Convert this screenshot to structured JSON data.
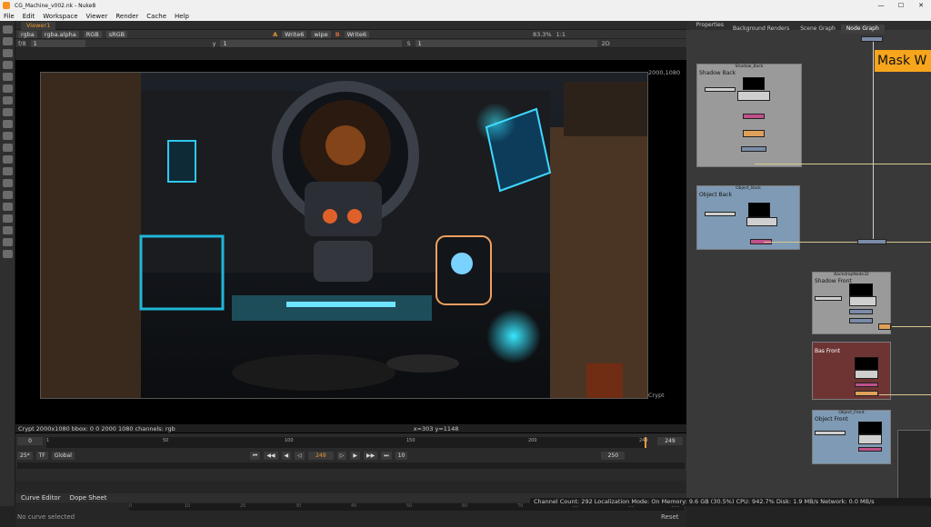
{
  "window": {
    "title": "CG_Machine_v002.nk - Nuke8",
    "controls": [
      "—",
      "☐",
      "✕"
    ]
  },
  "menu": [
    "File",
    "Edit",
    "Workspace",
    "Viewer",
    "Render",
    "Cache",
    "Help"
  ],
  "viewer": {
    "tab": "Viewer1",
    "row1": {
      "channels": "rgba",
      "channel_alpha": "rgba.alpha",
      "colorspace": "RGB",
      "lut": "sRGB",
      "input_a_label": "A",
      "input_a": "Write6",
      "wipe": "wipe",
      "input_b_label": "B",
      "input_b": "Write6",
      "zoom": "83.3%",
      "ratio": "1:1"
    },
    "row2": {
      "fstop": "f/8",
      "frame_field": "1",
      "y_label": "y",
      "y_value": "1",
      "s_label": "S",
      "s_value": "1",
      "mode": "2D"
    },
    "format_label_tr": "2000,1080",
    "format_label_br": "Crypt",
    "info_left": "Crypt 2000x1080  bbox: 0 0 2000 1080 channels: rgb",
    "info_coords": "x=303 y=1148"
  },
  "timeline": {
    "start": "0",
    "end": "249",
    "ticks": [
      "1",
      "50",
      "100",
      "150",
      "200",
      "249"
    ],
    "fps": "25*",
    "tf": "TF",
    "global": "Global",
    "current_frame": "249",
    "step": "10",
    "end_frame_field": "250",
    "playhead_fraction": 1.0
  },
  "panels": {
    "curve_editor_tab": "Curve Editor",
    "dope_sheet_tab": "Dope Sheet",
    "no_curve": "No curve selected",
    "reset": "Reset",
    "ruler": [
      "0",
      "5",
      "10",
      "15",
      "20",
      "25",
      "30",
      "35",
      "40",
      "45",
      "50",
      "55",
      "60",
      "65",
      "70",
      "75",
      "80",
      "85",
      "90",
      "95",
      "100"
    ]
  },
  "node_graph": {
    "tabs": [
      "Properties",
      "Background Renders",
      "Scene Graph",
      "Node Graph"
    ],
    "active_tab": "Node Graph",
    "sticky_note": "Mask W",
    "backdrops": [
      {
        "title": "Shadow_Back",
        "label": "Shadow Back",
        "color": "#9a9a9a"
      },
      {
        "title": "Object_Back",
        "label": "Object Back",
        "color": "#7f9ab4"
      },
      {
        "title": "BackdropNode32",
        "label": "Shadow Front",
        "color": "#9a9a9a"
      },
      {
        "title": "",
        "label": "Bas Front",
        "color": "#6e3434"
      },
      {
        "title": "Object_Front",
        "label": "Object Front",
        "color": "#7f9ab4"
      }
    ]
  },
  "status": "Channel Count: 292  Localization Mode: On  Memory: 9.6 GB (30.5%)  CPU: 942.7%  Disk: 1.9 MB/s  Network: 0.0 MB/s",
  "colors": {
    "accent": "#e89a34",
    "sticky": "#f7a51c",
    "grade_node": "#e0a05a",
    "merge_node": "#7a8aa8"
  }
}
